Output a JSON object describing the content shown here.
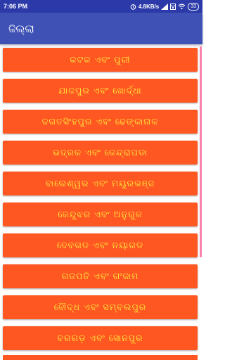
{
  "status_bar": {
    "time": "7:06 PM",
    "network_speed": "4.8KB/s",
    "battery_level": "33",
    "icons": [
      "alarm-icon",
      "signal-icon",
      "volte-icon",
      "wifi-icon",
      "battery-icon"
    ]
  },
  "app_bar": {
    "title": "ଜିଲ୍ଲା"
  },
  "districts": [
    "କଟକ ଏବଂ ପୁରୀ",
    "ଯାଜପୁର ଏବଂ ଖୋର୍ଦ୍ଧା",
    "ଜଗତସିଂହପୁର ଏବଂ ଢେଙ୍କାନାଳ",
    "ଭଦ୍ରକ ଏବଂ କେନ୍ଦ୍ରାପଡା",
    "ବାଲେଶ୍ୱର ଏବଂ ମୟୂରଭଞ୍ଜ",
    "କେନ୍ଦୁଝର ଏବଂ ଅନୁଗୁଳ",
    "ଦେବଗଡ ଏବଂ ନୟାଗଡ",
    "ଗଜପତି ଏବଂ ଗଂଜାମ",
    "ବୌଦ୍ଧ ଏବଂ ସମ୍ବଲପୁର",
    "ବରଗଡ଼ ଏବଂ ସୋନପୁର"
  ],
  "colors": {
    "status_bar": "#2b3aa8",
    "app_bar": "#3f51b5",
    "item_background": "#ff5722",
    "item_text": "#ffeb3b",
    "scroll_indicator": "#ff80ab"
  }
}
